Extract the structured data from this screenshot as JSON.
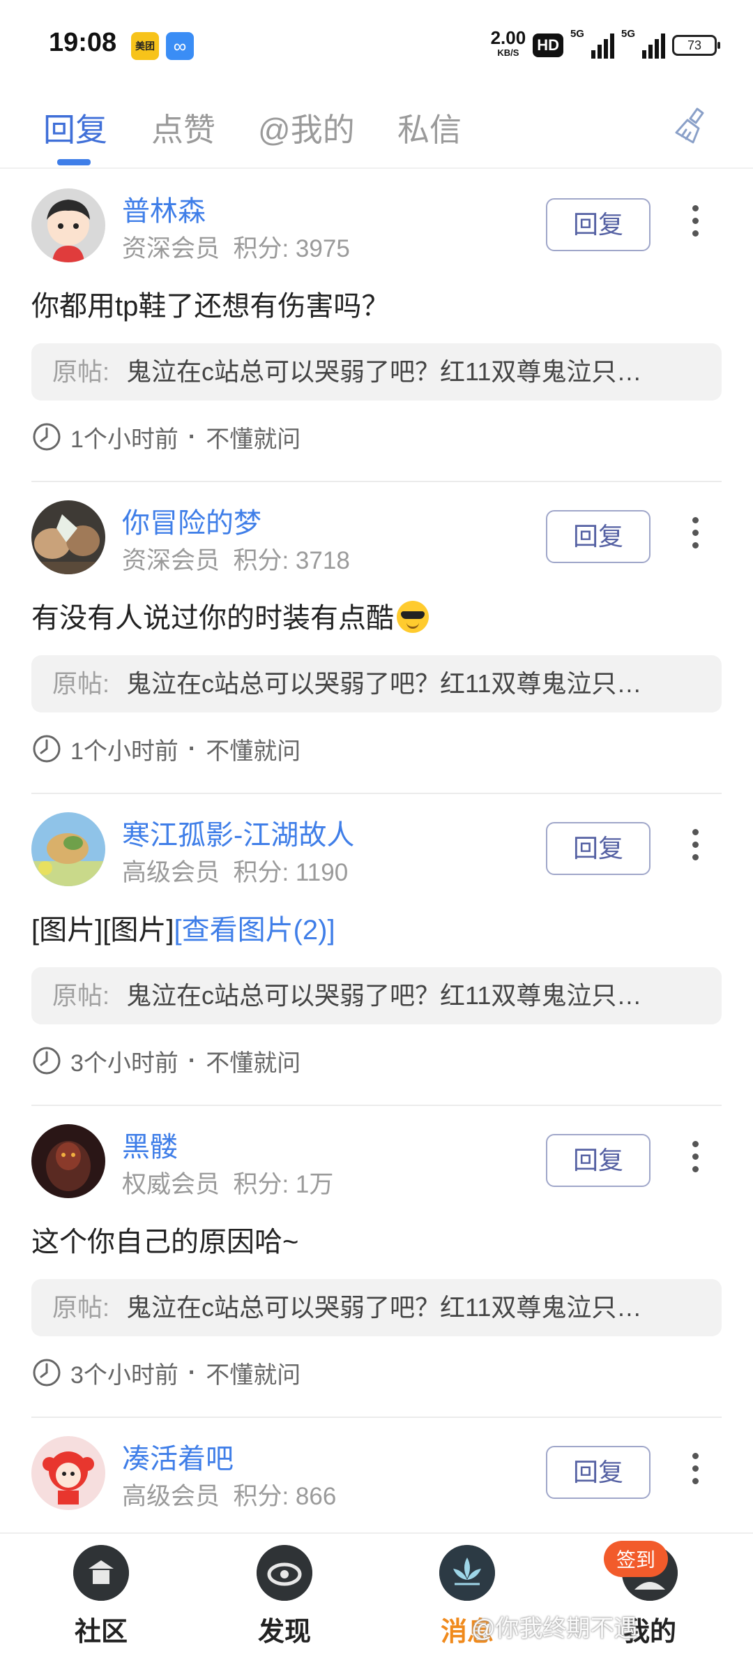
{
  "status": {
    "time": "19:08",
    "speed": "2.00",
    "speed_unit": "KB/S",
    "hd": "HD",
    "net1": "5G",
    "net2": "5G",
    "battery": "73",
    "app1_icon": "美团",
    "app2_icon": "∞"
  },
  "tabs": [
    "回复",
    "点赞",
    "@我的",
    "私信"
  ],
  "active_tab": 0,
  "messages": [
    {
      "name": "普林森",
      "level": "资深会员",
      "score": "积分: 3975",
      "content": "你都用tp鞋了还想有伤害吗？",
      "origin_label": "原帖:",
      "origin_text": "鬼泣在c站总可以哭弱了吧？红11双尊鬼泣只…",
      "time": "1个小时前",
      "forum": "不懂就问",
      "reply_label": "回复",
      "avatar_color": "#d9d9d9"
    },
    {
      "name": "你冒险的梦",
      "level": "资深会员",
      "score": "积分: 3718",
      "content": "有没有人说过你的时装有点酷",
      "origin_label": "原帖:",
      "origin_text": "鬼泣在c站总可以哭弱了吧？红11双尊鬼泣只…",
      "time": "1个小时前",
      "forum": "不懂就问",
      "reply_label": "回复",
      "avatar_color": "#6a5a4a"
    },
    {
      "name": "寒江孤影-江湖故人",
      "level": "高级会员",
      "score": "积分: 1190",
      "content_parts": [
        "[图片][图片]",
        "[查看图片(2)]"
      ],
      "origin_label": "原帖:",
      "origin_text": "鬼泣在c站总可以哭弱了吧？红11双尊鬼泣只…",
      "time": "3个小时前",
      "forum": "不懂就问",
      "reply_label": "回复",
      "avatar_color": "#8fb8d8"
    },
    {
      "name": "黑髅",
      "level": "权威会员",
      "score": "积分: 1万",
      "content": "这个你自己的原因哈~",
      "origin_label": "原帖:",
      "origin_text": "鬼泣在c站总可以哭弱了吧？红11双尊鬼泣只…",
      "time": "3个小时前",
      "forum": "不懂就问",
      "reply_label": "回复",
      "avatar_color": "#3a2020"
    },
    {
      "name": "凑活着吧",
      "level": "高级会员",
      "score": "积分: 866",
      "reply_label": "回复",
      "avatar_color": "#f6d6d6"
    }
  ],
  "nav": [
    "社区",
    "发现",
    "消息",
    "我的"
  ],
  "active_nav": 2,
  "badge": "签到",
  "watermark": "@你我终期不遇",
  "accent": "#3f7ee8",
  "nav_active_color": "#f08a1c"
}
